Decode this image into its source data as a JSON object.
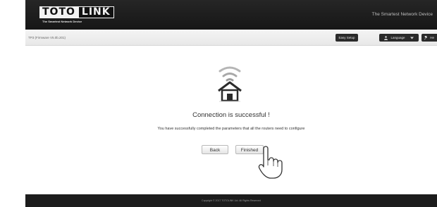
{
  "header": {
    "logo_part1": "TOTO",
    "logo_part2": "LINK",
    "logo_subtitle": "The Smartest Network Device",
    "tagline": "The Smartest Network Device"
  },
  "subbar": {
    "firmware": "TP3 (Firmware V5.0b.201)",
    "easy_setup": "Easy Setup",
    "language": "Language",
    "help": "He"
  },
  "main": {
    "title": "Connection is successful !",
    "subtitle": "You have successfully completed the parameters that all the routers need to configure",
    "back_label": "Back",
    "finished_label": "Finished"
  },
  "footer": {
    "copyright": "Copyright © 2017 TOTOLINK Ltd.   All Rights Reserved"
  },
  "icons": {
    "status": "wifi-house-icon",
    "cursor": "hand-pointer-icon",
    "language": "user-icon",
    "help": "wrench-icon",
    "dropdown": "caret-down-icon"
  }
}
